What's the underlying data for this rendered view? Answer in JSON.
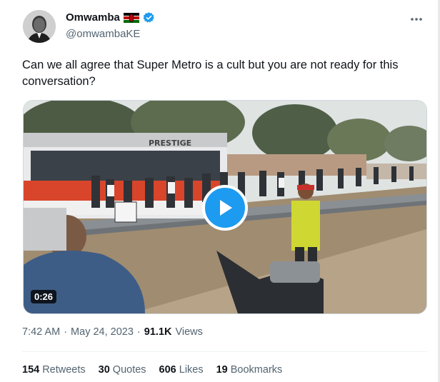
{
  "author": {
    "display_name": "Omwamba",
    "handle": "@omwambaKE",
    "flag_icon": "kenya-flag-icon",
    "verified_icon": "verified-badge-icon",
    "verified_color": "#1d9bf0"
  },
  "tweet": {
    "text": "Can we all agree that Super Metro is a cult but you are not ready for this conversation?"
  },
  "video": {
    "duration": "0:26",
    "bus_sign": "PRESTIGE",
    "play_icon": "play-icon"
  },
  "meta": {
    "time": "7:42 AM",
    "separator_1": "·",
    "date": "May 24, 2023",
    "separator_2": "·",
    "views_count": "91.1K",
    "views_label": "Views"
  },
  "stats": {
    "retweets": {
      "count": "154",
      "label": "Retweets"
    },
    "quotes": {
      "count": "30",
      "label": "Quotes"
    },
    "likes": {
      "count": "606",
      "label": "Likes"
    },
    "bookmarks": {
      "count": "19",
      "label": "Bookmarks"
    }
  },
  "colors": {
    "accent": "#1d9bf0",
    "secondary_text": "#536471",
    "primary_text": "#0f1419"
  }
}
